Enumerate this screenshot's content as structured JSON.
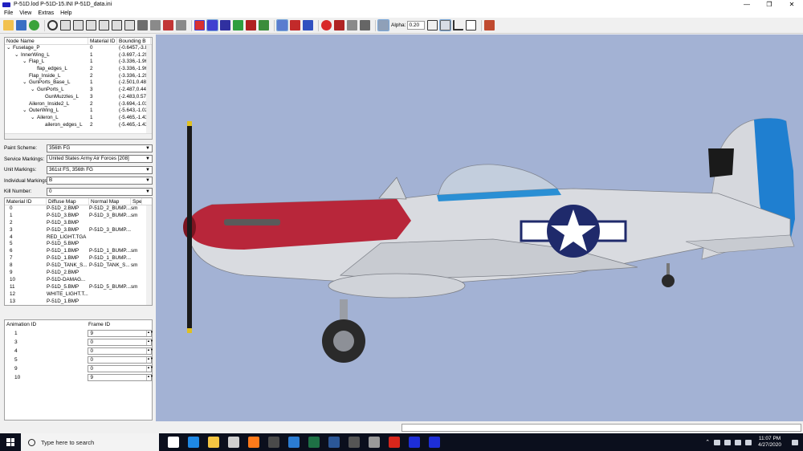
{
  "window": {
    "title": "P-51D.lod  P-51D-15.INI  P-51D_data.ini",
    "controls": [
      "—",
      "❐",
      "✕"
    ]
  },
  "menu": [
    "File",
    "View",
    "Extras",
    "Help"
  ],
  "toolbar": {
    "alpha_label": "Alpha:",
    "alpha_value": "0.20"
  },
  "node_tree": {
    "columns": [
      "Node Name",
      "Material ID",
      "Bounding B"
    ],
    "rows": [
      {
        "name": "Fuselage_P",
        "expander": "⌄",
        "indent": 0,
        "material": "0",
        "bounds": "(-0.6457,-3.8"
      },
      {
        "name": "InnerWing_L",
        "expander": "⌄",
        "indent": 1,
        "material": "1",
        "bounds": "(-3.697,-1.29"
      },
      {
        "name": "Flap_L",
        "expander": "⌄",
        "indent": 2,
        "material": "1",
        "bounds": "(-3.336,-1.96"
      },
      {
        "name": "flap_edges_L",
        "expander": "",
        "indent": 3,
        "material": "2",
        "bounds": "(-3.336,-1.96"
      },
      {
        "name": "Flap_Inside_L",
        "expander": "",
        "indent": 2,
        "material": "2",
        "bounds": "(-3.336,-1.29"
      },
      {
        "name": "GunPorts_Base_L",
        "expander": "⌄",
        "indent": 2,
        "material": "1",
        "bounds": "(-2.501,0.480"
      },
      {
        "name": "GunPorts_L",
        "expander": "⌄",
        "indent": 3,
        "material": "3",
        "bounds": "(-2.487,0.446"
      },
      {
        "name": "GunMuzzles_L",
        "expander": "",
        "indent": 4,
        "material": "3",
        "bounds": "(-2.483,0.579"
      },
      {
        "name": "Aileron_Inside2_L",
        "expander": "",
        "indent": 2,
        "material": "2",
        "bounds": "(-3.694,-1.03"
      },
      {
        "name": "OuterWing_L",
        "expander": "⌄",
        "indent": 2,
        "material": "1",
        "bounds": "(-5.643,-1.02"
      },
      {
        "name": "Aileron_L",
        "expander": "⌄",
        "indent": 3,
        "material": "1",
        "bounds": "(-5.465,-1.43"
      },
      {
        "name": "aileron_edges_L",
        "expander": "",
        "indent": 4,
        "material": "2",
        "bounds": "(-5.465,-1.43"
      }
    ]
  },
  "properties": [
    {
      "label": "Paint Scheme:",
      "value": "356th FG"
    },
    {
      "label": "Service Markings:",
      "value": "United States Army Air Forces [208]"
    },
    {
      "label": "Unit Markings:",
      "value": "361st FS, 356th FG"
    },
    {
      "label": "Individual Markings:",
      "value": "B"
    },
    {
      "label": "Kill Number:",
      "value": "0"
    }
  ],
  "materials": {
    "columns": [
      "Material ID",
      "Diffuse Map",
      "Normal Map",
      "Spe"
    ],
    "rows": [
      [
        "0",
        "P-51D_2.BMP",
        "P-51D_2_BUMP....",
        "sm"
      ],
      [
        "1",
        "P-51D_3.BMP",
        "P-51D_3_BUMP....",
        "sm"
      ],
      [
        "2",
        "P-51D_3.BMP",
        "",
        ""
      ],
      [
        "3",
        "P-51D_3.BMP",
        "P-51D_3_BUMP....",
        ""
      ],
      [
        "4",
        "RED_LIGHT.TGA",
        "",
        ""
      ],
      [
        "5",
        "P-51D_5.BMP",
        "",
        ""
      ],
      [
        "6",
        "P-51D_1.BMP",
        "P-51D_1_BUMP....",
        "sm"
      ],
      [
        "7",
        "P-51D_1.BMP",
        "P-51D_1_BUMP....",
        ""
      ],
      [
        "8",
        "P-51D_TANK_S...",
        "P-51D_TANK_S...",
        "sm"
      ],
      [
        "9",
        "P-51D_2.BMP",
        "",
        ""
      ],
      [
        "10",
        "P-51D-DAMAG...",
        "",
        ""
      ],
      [
        "11",
        "P-51D_5.BMP",
        "P-51D_5_BUMP....",
        "sm"
      ],
      [
        "12",
        "WHITE_LIGHT.T...",
        "",
        ""
      ],
      [
        "13",
        "P-51D_1.BMP",
        "",
        ""
      ]
    ]
  },
  "animations": {
    "columns": [
      "Animation ID",
      "Frame ID"
    ],
    "rows": [
      {
        "id": "1",
        "frame": "9"
      },
      {
        "id": "3",
        "frame": "0"
      },
      {
        "id": "4",
        "frame": "0"
      },
      {
        "id": "5",
        "frame": "0"
      },
      {
        "id": "9",
        "frame": "0"
      },
      {
        "id": "10",
        "frame": "9"
      }
    ]
  },
  "viewport": {
    "background": "#a3b2d4",
    "nose_color": "#b8263a",
    "rudder_color": "#1f7fd0"
  },
  "taskbar": {
    "search_placeholder": "Type here to search",
    "time": "11:07 PM",
    "date": "4/27/2020",
    "apps": [
      {
        "name": "task-view",
        "color": "#ffffff"
      },
      {
        "name": "edge",
        "color": "#1e88e5"
      },
      {
        "name": "explorer",
        "color": "#f5c542"
      },
      {
        "name": "store",
        "color": "#cfcfcf"
      },
      {
        "name": "firefox",
        "color": "#ff7a1a"
      },
      {
        "name": "notepad",
        "color": "#4a4a4a"
      },
      {
        "name": "mail",
        "color": "#2b7cd3"
      },
      {
        "name": "excel",
        "color": "#1e7145"
      },
      {
        "name": "word",
        "color": "#2b5797"
      },
      {
        "name": "calculator",
        "color": "#555555"
      },
      {
        "name": "game",
        "color": "#9a9a9a"
      },
      {
        "name": "acrobat",
        "color": "#d7261b"
      },
      {
        "name": "lod-app",
        "color": "#1d2ed8"
      },
      {
        "name": "lod-app-active",
        "color": "#1d2ed8"
      }
    ]
  }
}
